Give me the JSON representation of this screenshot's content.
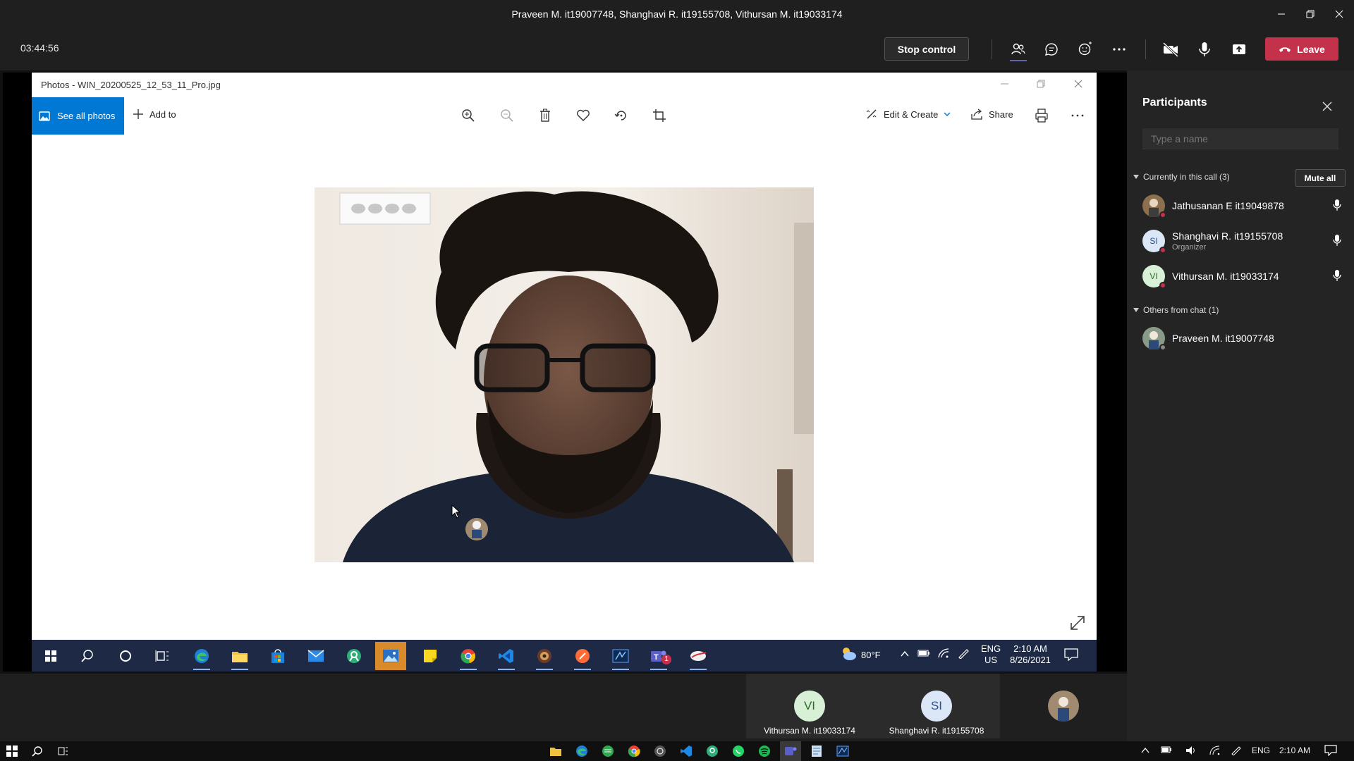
{
  "teams": {
    "window_title": "Praveen M. it19007748, Shanghavi R. it19155708, Vithursan M. it19033174",
    "call_timer": "03:44:56",
    "stop_control_label": "Stop control",
    "leave_label": "Leave",
    "icons": [
      "people-icon",
      "chat-icon",
      "reactions-icon",
      "more-icon",
      "camera-off-icon",
      "mic-icon",
      "share-tray-icon",
      "phone-icon"
    ]
  },
  "photos": {
    "title": "Photos - WIN_20200525_12_53_11_Pro.jpg",
    "see_all_label": "See all photos",
    "add_to_label": "Add to",
    "edit_create_label": "Edit & Create",
    "share_label": "Share",
    "tools": [
      "zoom-in-icon",
      "zoom-out-icon",
      "delete-icon",
      "favorite-icon",
      "rotate-icon",
      "crop-icon"
    ]
  },
  "shared_taskbar": {
    "weather": "80°F",
    "lang_top": "ENG",
    "lang_bottom": "US",
    "time": "2:10 AM",
    "date": "8/26/2021",
    "apps": [
      "start-icon",
      "search-icon",
      "cortana-icon",
      "task-view-icon",
      "edge-icon",
      "file-explorer-icon",
      "store-icon",
      "mail-icon",
      "app-icon",
      "photos-icon",
      "sticky-notes-icon",
      "chrome-icon",
      "vscode-icon",
      "game-icon",
      "postman-icon",
      "app-icon",
      "teams-icon",
      "app-icon"
    ],
    "teams_badge": "1"
  },
  "tiles": [
    {
      "initials": "VI",
      "name": "Vithursan M. it19033174",
      "color": "#d7f0d6",
      "text_color": "#2f6b2c"
    },
    {
      "initials": "SI",
      "name": "Shanghavi R. it19155708",
      "color": "#dbe6f7",
      "text_color": "#2d4e8a"
    }
  ],
  "participants": {
    "title": "Participants",
    "search_placeholder": "Type a name",
    "in_call_header": "Currently in this call (3)",
    "mute_all_label": "Mute all",
    "in_call": [
      {
        "name": "Jathusanan E it19049878",
        "role": "",
        "initials": "",
        "avatar_color": "#8b6f4e",
        "text_color": "#ffffff"
      },
      {
        "name": "Shanghavi R. it19155708",
        "role": "Organizer",
        "initials": "SI",
        "avatar_color": "#dbe6f7",
        "text_color": "#2d4e8a"
      },
      {
        "name": "Vithursan M. it19033174",
        "role": "",
        "initials": "VI",
        "avatar_color": "#d7f0d6",
        "text_color": "#2f6b2c"
      }
    ],
    "others_header": "Others from chat (1)",
    "others": [
      {
        "name": "Praveen M. it19007748",
        "initials": "",
        "avatar_color": "#8a9a8a"
      }
    ]
  },
  "host_taskbar": {
    "lang": "ENG",
    "time": "2:10 AM"
  }
}
